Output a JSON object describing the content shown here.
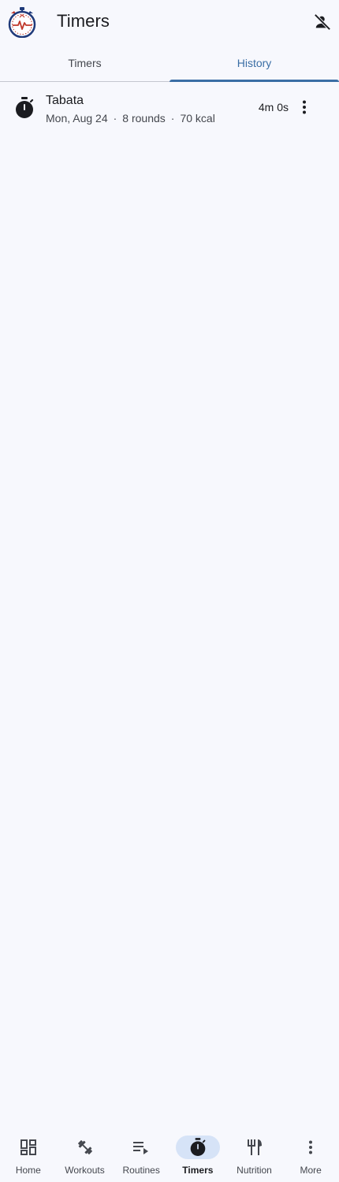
{
  "app": {
    "title": "Timers",
    "logo_icon": "stopwatch-heartbeat-logo",
    "action_icon": "person-off-icon"
  },
  "tabs": [
    {
      "label": "Timers",
      "active": false
    },
    {
      "label": "History",
      "active": true
    }
  ],
  "colors": {
    "accent": "#3a6ea5",
    "background": "#f7f8fd",
    "nav_active_pill": "#d6e3f7"
  },
  "history": [
    {
      "icon": "timer-icon",
      "name": "Tabata",
      "date": "Mon, Aug 24",
      "rounds": "8 rounds",
      "calories": "70 kcal",
      "separator": "·",
      "duration": "4m 0s",
      "menu_icon": "more-vert-icon"
    }
  ],
  "bottom_nav": [
    {
      "label": "Home",
      "icon": "dashboard-icon",
      "active": false
    },
    {
      "label": "Workouts",
      "icon": "dumbbell-icon",
      "active": false
    },
    {
      "label": "Routines",
      "icon": "playlist-play-icon",
      "active": false
    },
    {
      "label": "Timers",
      "icon": "timer-icon",
      "active": true
    },
    {
      "label": "Nutrition",
      "icon": "restaurant-icon",
      "active": false
    },
    {
      "label": "More",
      "icon": "more-vert-icon",
      "active": false
    }
  ]
}
